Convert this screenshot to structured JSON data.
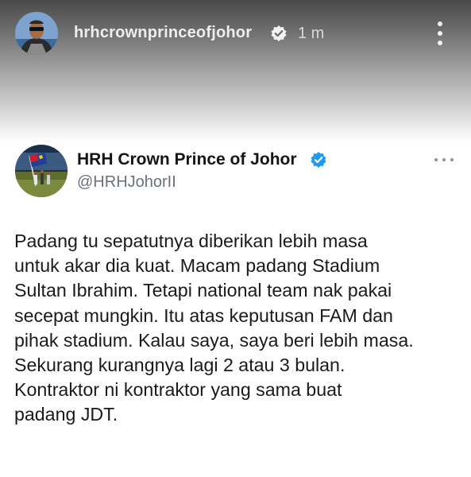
{
  "story": {
    "username": "hrhcrownprinceofjohor",
    "time": "1 m",
    "avatar_icon": "profile-photo-man-sunglasses",
    "verified_icon": "verified-badge-icon",
    "menu_icon": "vertical-ellipsis-icon"
  },
  "tweet": {
    "display_name": "HRH Crown Prince of Johor",
    "handle": "@HRHJohorII",
    "avatar_icon": "profile-photo-flag-field",
    "verified_icon": "verified-badge-icon",
    "verified_color": "#1d9bf0",
    "menu_icon": "horizontal-ellipsis-icon",
    "body_lines": [
      "Padang tu sepatutnya diberikan lebih masa",
      "untuk akar dia kuat. Macam padang Stadium",
      "Sultan Ibrahim. Tetapi national team nak pakai",
      "secepat mungkin. Itu atas keputusan FAM dan",
      "pihak stadium. Kalau saya, saya beri lebih masa.",
      "Sekurang kurangnya lagi 2 atau 3 bulan.",
      "Kontraktor ni kontraktor yang sama buat",
      "padang JDT."
    ]
  }
}
